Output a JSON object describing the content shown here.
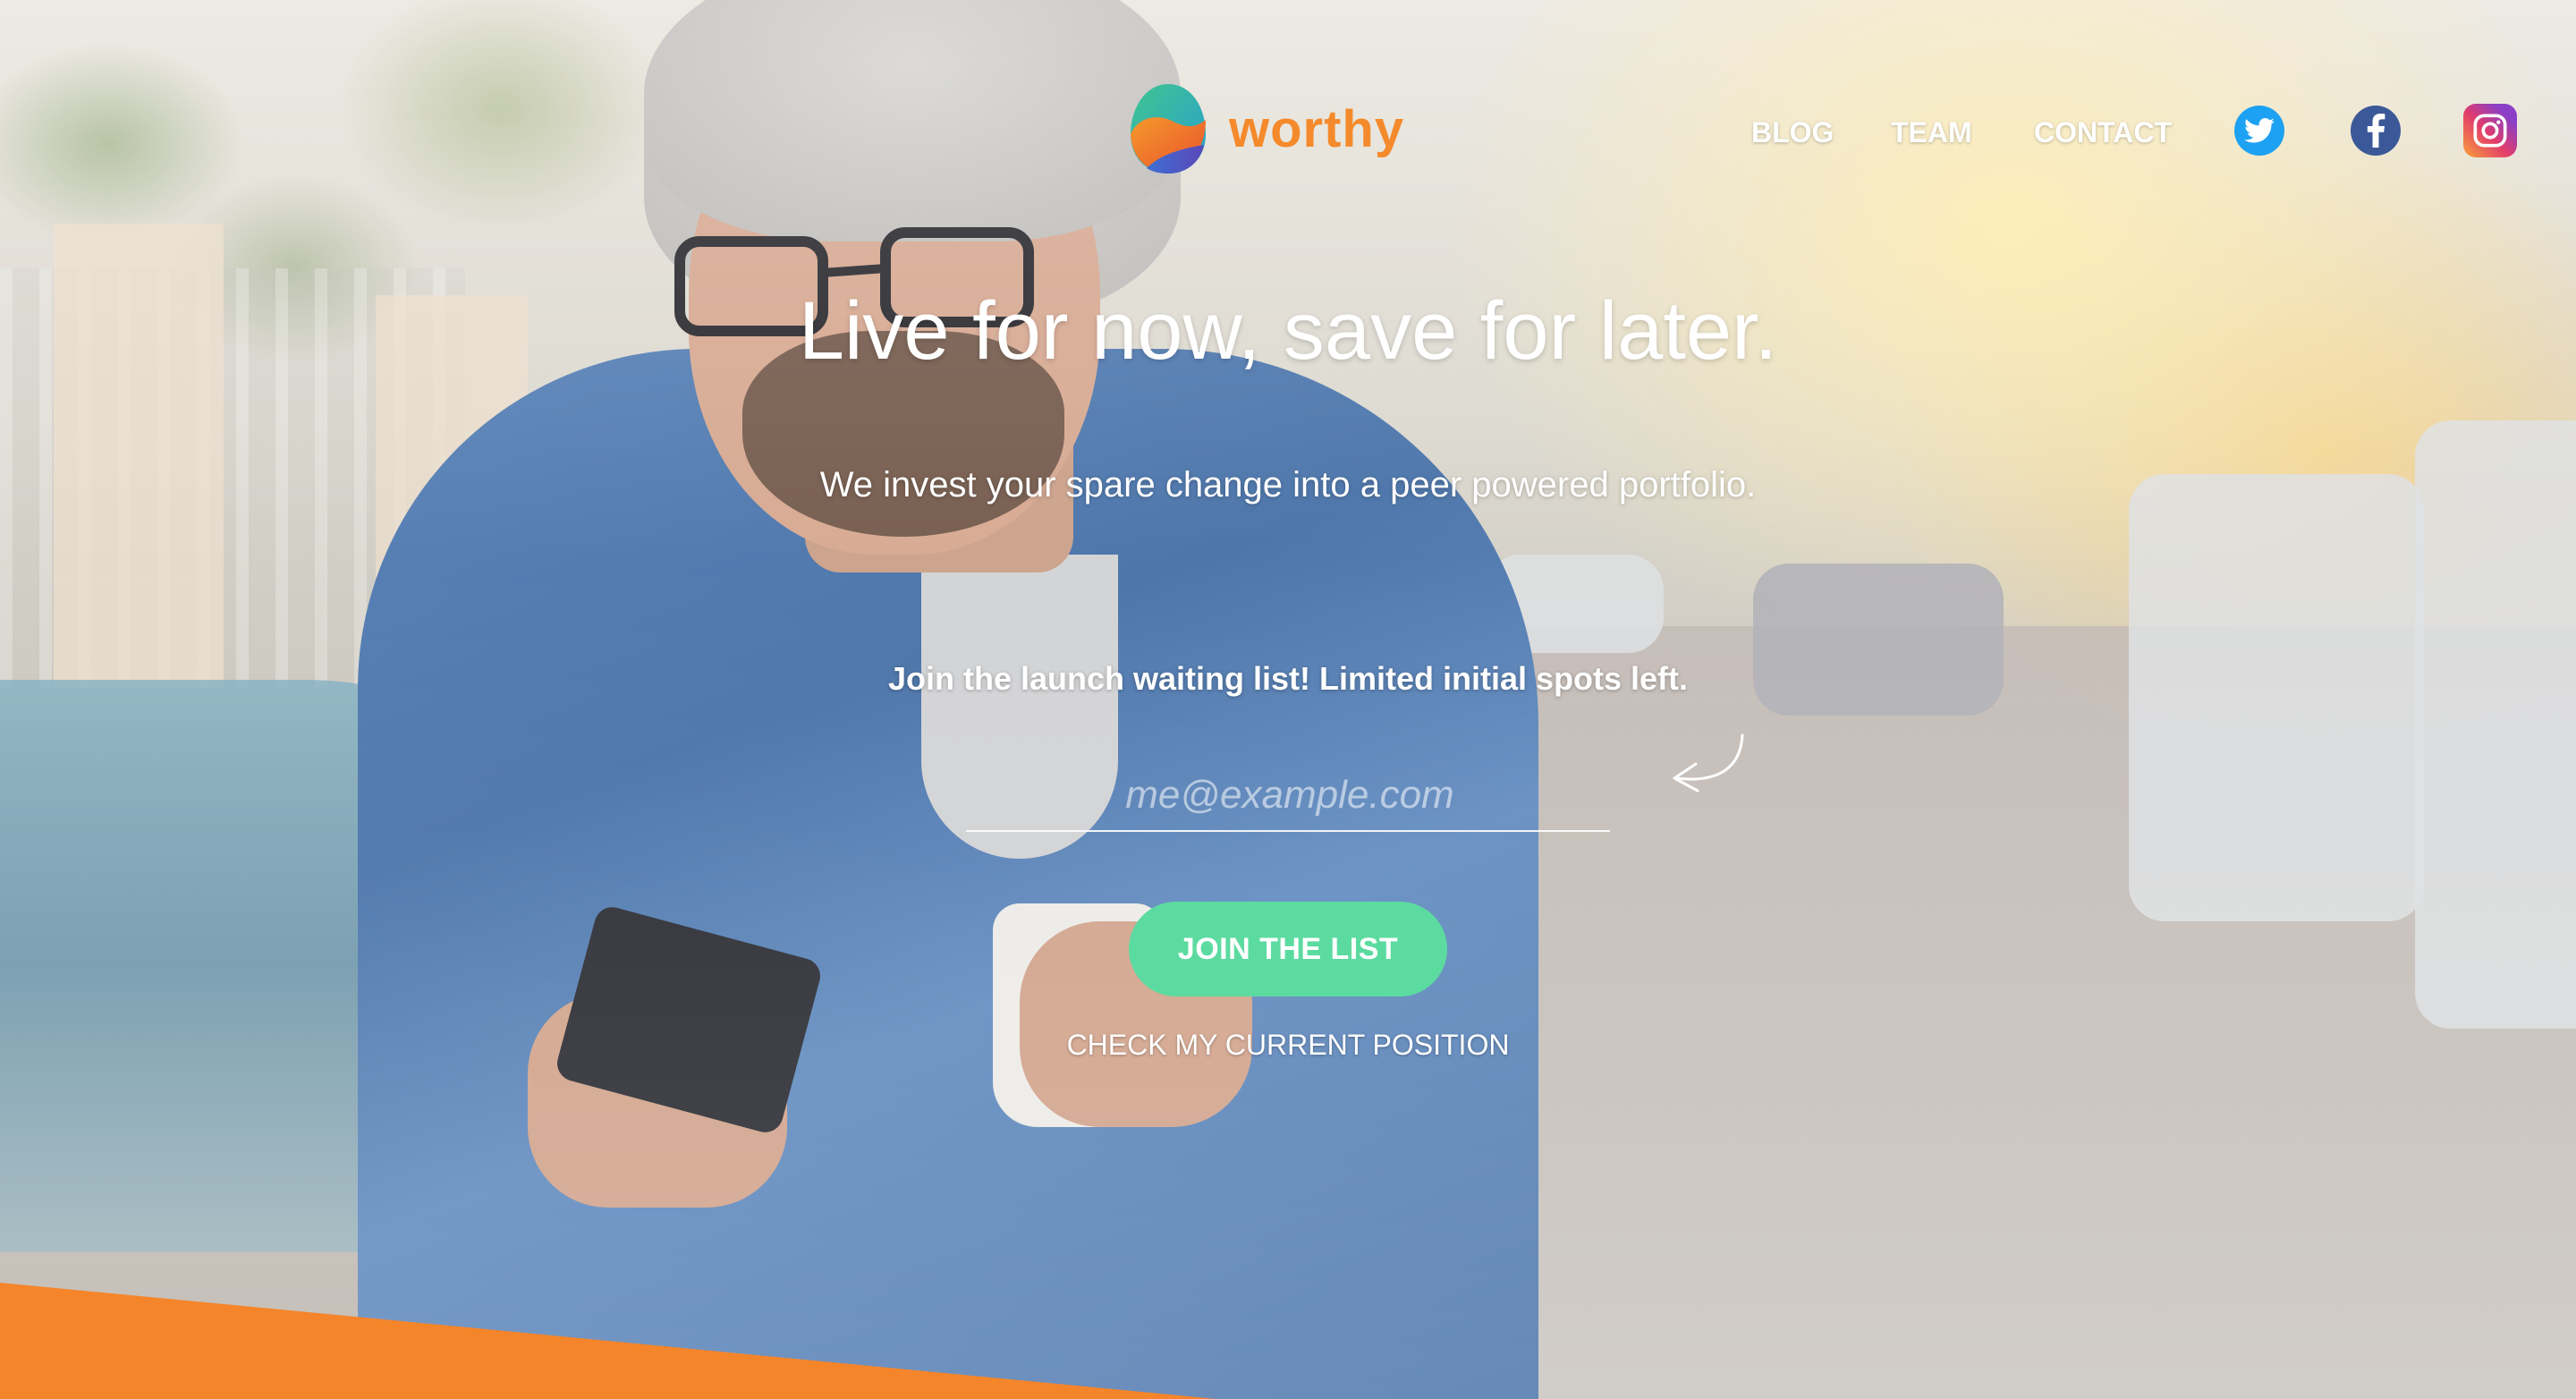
{
  "brand": {
    "name": "worthy",
    "color": "#f48a2c"
  },
  "nav": {
    "items": [
      {
        "label": "BLOG"
      },
      {
        "label": "TEAM"
      },
      {
        "label": "CONTACT"
      }
    ],
    "social": [
      {
        "icon": "twitter-icon",
        "color": "#1da1f2"
      },
      {
        "icon": "facebook-icon",
        "color": "#3b5998"
      },
      {
        "icon": "instagram-icon",
        "color": "#c13584"
      }
    ]
  },
  "hero": {
    "headline": "Live for now, save for later.",
    "subhead": "We invest your spare change into a peer powered portfolio.",
    "waitlist_text": "Join the launch waiting list! Limited initial spots left.",
    "email_placeholder": "me@example.com",
    "join_button": "JOIN THE LIST",
    "check_position": "CHECK MY CURRENT POSITION"
  },
  "colors": {
    "accent_green": "#5cdba0",
    "accent_orange": "#f5852b"
  }
}
